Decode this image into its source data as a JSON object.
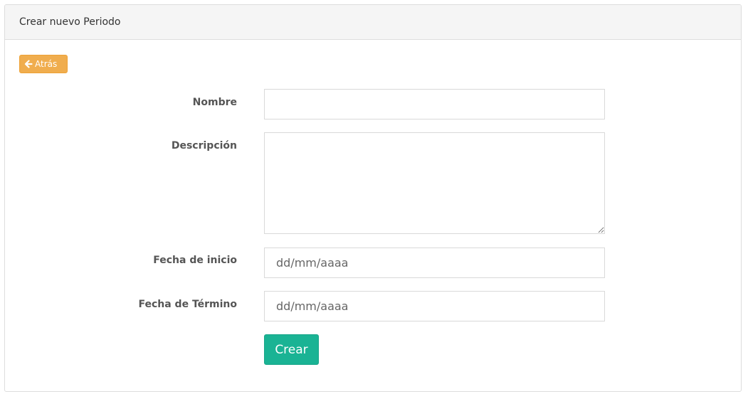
{
  "panel": {
    "title": "Crear nuevo Periodo"
  },
  "back_button": {
    "label": "Atrás",
    "icon": "arrow-left-icon",
    "color": "#f0ad4e"
  },
  "form": {
    "nombre": {
      "label": "Nombre",
      "value": "",
      "placeholder": ""
    },
    "descripcion": {
      "label": "Descripción",
      "value": "",
      "placeholder": ""
    },
    "fecha_inicio": {
      "label": "Fecha de inicio",
      "value": "",
      "placeholder": "dd/mm/aaaa"
    },
    "fecha_termino": {
      "label": "Fecha de Término",
      "value": "",
      "placeholder": "dd/mm/aaaa"
    },
    "submit": {
      "label": "Crear",
      "color": "#1ab394"
    }
  }
}
